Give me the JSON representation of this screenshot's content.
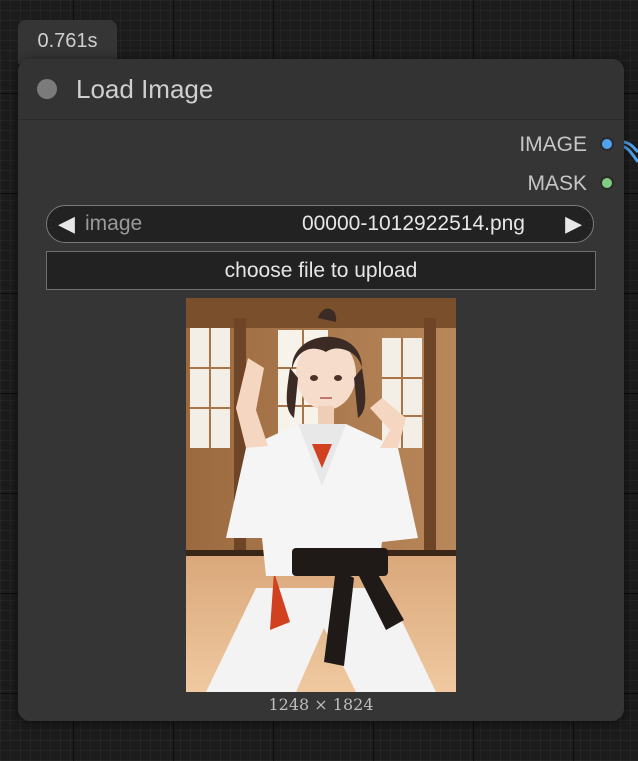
{
  "timer": {
    "label": "0.761s"
  },
  "node": {
    "title": "Load Image",
    "outputs": [
      {
        "label": "IMAGE",
        "color": "#4fa3ee"
      },
      {
        "label": "MASK",
        "color": "#80cc80"
      }
    ],
    "widgets": {
      "image_combo": {
        "label": "image",
        "value": "00000-1012922514.png"
      },
      "upload_button": {
        "label": "choose file to upload"
      }
    },
    "preview": {
      "dimensions": "1248 × 1824"
    }
  },
  "icons": {
    "prev": "arrow-left-icon",
    "next": "arrow-right-icon",
    "collapse": "collapse-dot-icon"
  },
  "colors": {
    "node_bg": "#353535",
    "canvas_bg": "#1c1c1c",
    "link_wire": "#4fa3ee"
  }
}
